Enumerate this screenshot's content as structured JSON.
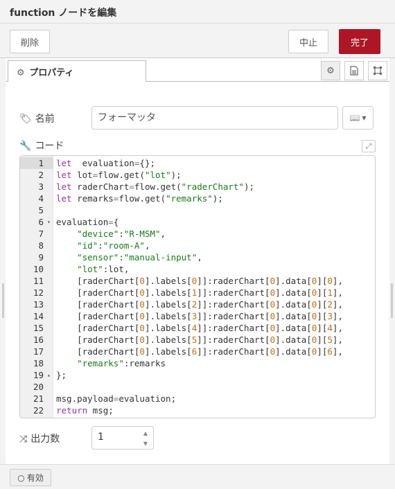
{
  "title": "function ノードを編集",
  "toolbar": {
    "delete_label": "削除",
    "cancel_label": "中止",
    "done_label": "完了"
  },
  "tabs": {
    "properties_label": "プロパティ"
  },
  "form": {
    "name_label": "名前",
    "name_value": "フォーマッタ",
    "code_label": "コード",
    "outputs_label": "出力数",
    "outputs_value": "1"
  },
  "footer": {
    "enabled_label": "有効"
  },
  "code_lines": [
    [
      [
        "kw",
        "let"
      ],
      [
        "",
        "  evaluation"
      ],
      [
        "op",
        "="
      ],
      [
        "br",
        "{}"
      ],
      [
        "",
        ";"
      ]
    ],
    [
      [
        "kw",
        "let"
      ],
      [
        "",
        " lot"
      ],
      [
        "op",
        "="
      ],
      [
        "",
        "flow.get("
      ],
      [
        "st",
        "\"lot\""
      ],
      [
        "",
        ");"
      ]
    ],
    [
      [
        "kw",
        "let"
      ],
      [
        "",
        " raderChart"
      ],
      [
        "op",
        "="
      ],
      [
        "",
        "flow.get("
      ],
      [
        "st",
        "\"raderChart\""
      ],
      [
        "",
        ");"
      ]
    ],
    [
      [
        "kw",
        "let"
      ],
      [
        "",
        " remarks"
      ],
      [
        "op",
        "="
      ],
      [
        "",
        "flow.get("
      ],
      [
        "st",
        "\"remarks\""
      ],
      [
        "",
        ");"
      ]
    ],
    [],
    [
      [
        "",
        "evaluation"
      ],
      [
        "op",
        "="
      ],
      [
        "br",
        "{"
      ]
    ],
    [
      [
        "",
        "    "
      ],
      [
        "st",
        "\"device\""
      ],
      [
        "",
        ":"
      ],
      [
        "st",
        "\"R-MSM\""
      ],
      [
        "",
        ","
      ]
    ],
    [
      [
        "",
        "    "
      ],
      [
        "st",
        "\"id\""
      ],
      [
        "",
        ":"
      ],
      [
        "st",
        "\"room-A\""
      ],
      [
        "",
        ","
      ]
    ],
    [
      [
        "",
        "    "
      ],
      [
        "st",
        "\"sensor\""
      ],
      [
        "",
        ":"
      ],
      [
        "st",
        "\"manual-input\""
      ],
      [
        "",
        ","
      ]
    ],
    [
      [
        "",
        "    "
      ],
      [
        "st",
        "\"lot\""
      ],
      [
        "",
        ":lot,"
      ]
    ],
    [
      [
        "",
        "    [raderChart["
      ],
      [
        "nm",
        "0"
      ],
      [
        "",
        "].labels["
      ],
      [
        "nm",
        "0"
      ],
      [
        "",
        "]]:raderChart["
      ],
      [
        "nm",
        "0"
      ],
      [
        "",
        "].data["
      ],
      [
        "nm",
        "0"
      ],
      [
        "",
        "]["
      ],
      [
        "nm",
        "0"
      ],
      [
        "",
        "],"
      ]
    ],
    [
      [
        "",
        "    [raderChart["
      ],
      [
        "nm",
        "0"
      ],
      [
        "",
        "].labels["
      ],
      [
        "nm",
        "1"
      ],
      [
        "",
        "]]:raderChart["
      ],
      [
        "nm",
        "0"
      ],
      [
        "",
        "].data["
      ],
      [
        "nm",
        "0"
      ],
      [
        "",
        "]["
      ],
      [
        "nm",
        "1"
      ],
      [
        "",
        "],"
      ]
    ],
    [
      [
        "",
        "    [raderChart["
      ],
      [
        "nm",
        "0"
      ],
      [
        "",
        "].labels["
      ],
      [
        "nm",
        "2"
      ],
      [
        "",
        "]]:raderChart["
      ],
      [
        "nm",
        "0"
      ],
      [
        "",
        "].data["
      ],
      [
        "nm",
        "0"
      ],
      [
        "",
        "]["
      ],
      [
        "nm",
        "2"
      ],
      [
        "",
        "],"
      ]
    ],
    [
      [
        "",
        "    [raderChart["
      ],
      [
        "nm",
        "0"
      ],
      [
        "",
        "].labels["
      ],
      [
        "nm",
        "3"
      ],
      [
        "",
        "]]:raderChart["
      ],
      [
        "nm",
        "0"
      ],
      [
        "",
        "].data["
      ],
      [
        "nm",
        "0"
      ],
      [
        "",
        "]["
      ],
      [
        "nm",
        "3"
      ],
      [
        "",
        "],"
      ]
    ],
    [
      [
        "",
        "    [raderChart["
      ],
      [
        "nm",
        "0"
      ],
      [
        "",
        "].labels["
      ],
      [
        "nm",
        "4"
      ],
      [
        "",
        "]]:raderChart["
      ],
      [
        "nm",
        "0"
      ],
      [
        "",
        "].data["
      ],
      [
        "nm",
        "0"
      ],
      [
        "",
        "]["
      ],
      [
        "nm",
        "4"
      ],
      [
        "",
        "],"
      ]
    ],
    [
      [
        "",
        "    [raderChart["
      ],
      [
        "nm",
        "0"
      ],
      [
        "",
        "].labels["
      ],
      [
        "nm",
        "5"
      ],
      [
        "",
        "]]:raderChart["
      ],
      [
        "nm",
        "0"
      ],
      [
        "",
        "].data["
      ],
      [
        "nm",
        "0"
      ],
      [
        "",
        "]["
      ],
      [
        "nm",
        "5"
      ],
      [
        "",
        "],"
      ]
    ],
    [
      [
        "",
        "    [raderChart["
      ],
      [
        "nm",
        "0"
      ],
      [
        "",
        "].labels["
      ],
      [
        "nm",
        "6"
      ],
      [
        "",
        "]]:raderChart["
      ],
      [
        "nm",
        "0"
      ],
      [
        "",
        "].data["
      ],
      [
        "nm",
        "0"
      ],
      [
        "",
        "]["
      ],
      [
        "nm",
        "6"
      ],
      [
        "",
        "],"
      ]
    ],
    [
      [
        "",
        "    "
      ],
      [
        "st",
        "\"remarks\""
      ],
      [
        "",
        ":remarks"
      ]
    ],
    [
      [
        "br",
        "}"
      ],
      [
        "",
        ";"
      ]
    ],
    [],
    [
      [
        "",
        "msg.payload"
      ],
      [
        "op",
        "="
      ],
      [
        "",
        "evaluation;"
      ]
    ],
    [
      [
        "kw",
        "return"
      ],
      [
        "",
        " msg;"
      ]
    ]
  ]
}
